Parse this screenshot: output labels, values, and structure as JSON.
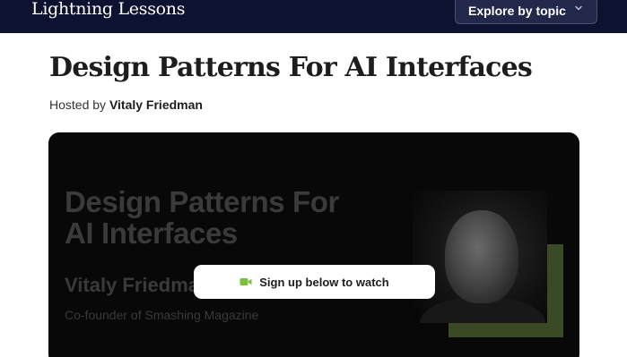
{
  "header": {
    "brand": "Lightning Lessons",
    "explore_label": "Explore by topic"
  },
  "lesson": {
    "title": "Design Patterns For AI Interfaces",
    "hosted_prefix": "Hosted by",
    "host": "Vitaly Friedman"
  },
  "video": {
    "title_line1": "Design Patterns For",
    "title_line2": "AI Interfaces",
    "speaker": "Vitaly Friedman",
    "speaker_role": "Co-founder of Smashing Magazine",
    "cta_label": "Sign up below to watch",
    "cta_icon": "video-camera-icon"
  },
  "colors": {
    "nav_bg": "#0d1230",
    "video_bg": "#080808",
    "accent_green": "#7bbf3a"
  }
}
